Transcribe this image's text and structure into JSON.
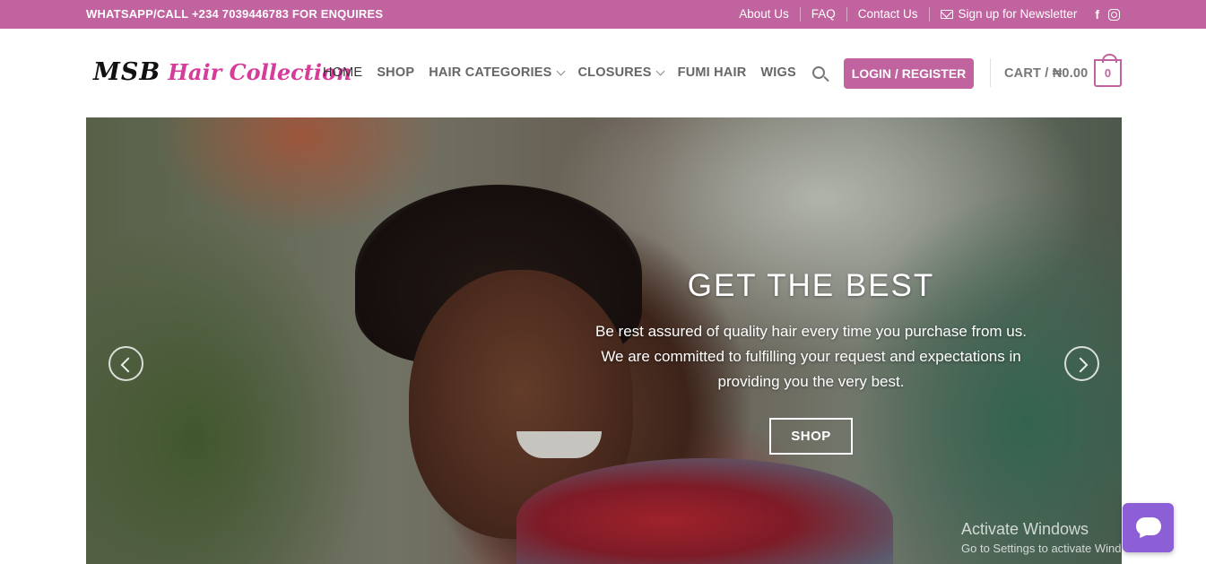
{
  "topbar": {
    "contact": "WHATSAPP/CALL +234 7039446783 FOR ENQUIRES",
    "links": [
      "About Us",
      "FAQ",
      "Contact Us"
    ],
    "newsletter": "Sign up for Newsletter",
    "social": [
      "facebook-icon",
      "instagram-icon"
    ],
    "color": "#c0639e"
  },
  "header": {
    "logo_mark": "MSB",
    "logo_text": "Hair Collection",
    "nav": {
      "home": "HOME",
      "shop": "SHOP",
      "hair_categories": "HAIR CATEGORIES",
      "closures": "CLOSURES",
      "fumi_hair": "FUMI HAIR",
      "wigs": "WIGS"
    },
    "login": "LOGIN / REGISTER",
    "cart_label": "CART / ₦0.00",
    "cart_count": "0",
    "accent": "#c0639e"
  },
  "hero": {
    "title": "GET THE BEST",
    "text": "Be rest assured of quality hair every time you purchase from us. We are committed to fulfilling your request and expectations in providing you the very best.",
    "button": "SHOP"
  },
  "watermark": {
    "line1": "Activate Windows",
    "line2": "Go to Settings to activate Windows."
  },
  "chat": {
    "icon": "chat-bubble-icon",
    "color": "#8c5fd6"
  }
}
